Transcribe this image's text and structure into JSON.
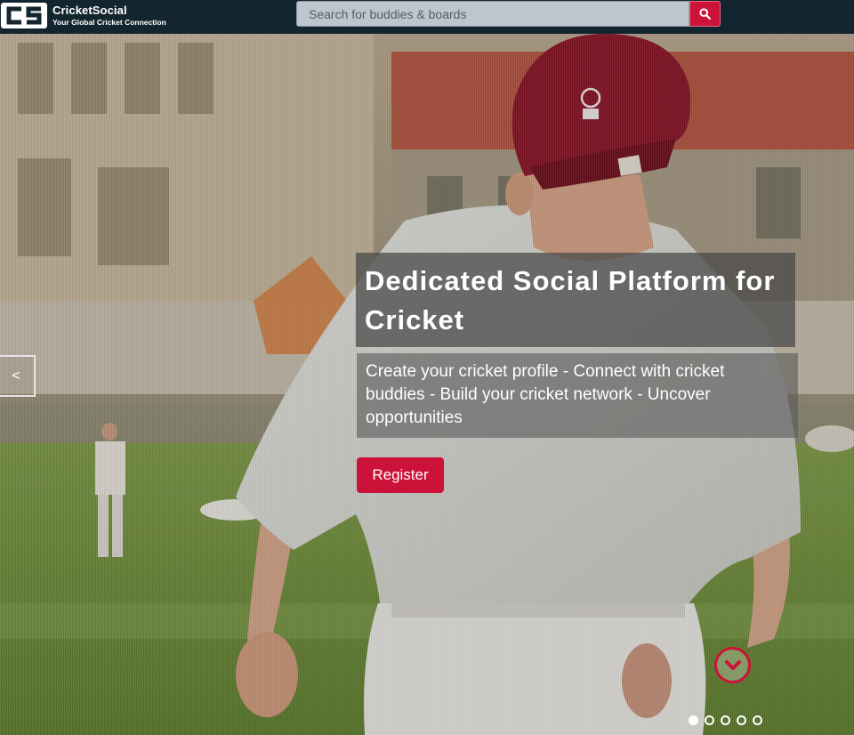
{
  "brand": {
    "name": "CricketSocial",
    "tagline": "Your Global Cricket Connection",
    "mark_text": "CS"
  },
  "search": {
    "placeholder": "Search for buddies & boards",
    "button_icon": "search-icon"
  },
  "hero": {
    "headline": "Dedicated Social Platform for Cricket",
    "subtext": "Create your cricket profile - Connect with cricket buddies - Build your cricket network - Uncover opportunities",
    "register_label": "Register",
    "prev_label": "<",
    "down_icon": "chevron-down-icon",
    "slide_count": 5,
    "active_slide": 1
  },
  "colors": {
    "topbar": "#13262f",
    "accent": "#cc1238",
    "search_field": "#bcc6cc"
  }
}
